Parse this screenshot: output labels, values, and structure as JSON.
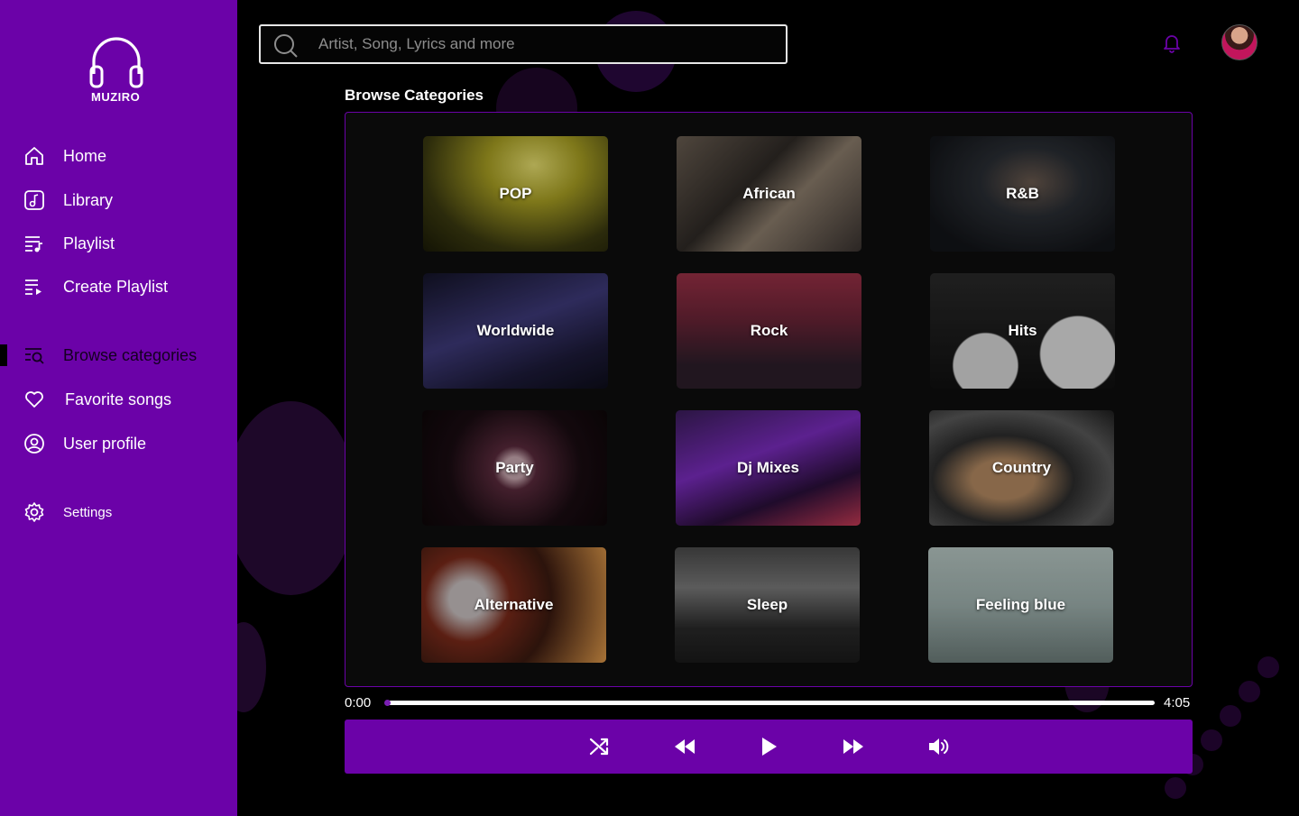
{
  "app": {
    "name": "MUZIRO"
  },
  "sidebar": {
    "items": [
      {
        "label": "Home",
        "icon": "home-icon"
      },
      {
        "label": "Library",
        "icon": "library-icon"
      },
      {
        "label": "Playlist",
        "icon": "playlist-icon"
      },
      {
        "label": "Create Playlist",
        "icon": "create-playlist-icon"
      },
      {
        "label": "Browse categories",
        "icon": "browse-icon",
        "active": true
      },
      {
        "label": "Favorite songs",
        "icon": "heart-icon"
      },
      {
        "label": "User profile",
        "icon": "user-circle-icon"
      },
      {
        "label": "Settings",
        "icon": "gear-icon"
      }
    ]
  },
  "search": {
    "placeholder": "Artist, Song, Lyrics and more"
  },
  "main": {
    "title": "Browse Categories",
    "categories": [
      "POP",
      "African",
      "R&B",
      "Worldwide",
      "Rock",
      "Hits",
      "Party",
      "Dj Mixes",
      "Country",
      "Alternative",
      "Sleep",
      "Feeling blue"
    ]
  },
  "player": {
    "current_time": "0:00",
    "duration": "4:05",
    "progress": 0.0,
    "controls": [
      "shuffle-icon",
      "rewind-icon",
      "play-icon",
      "fast-forward-icon",
      "volume-icon"
    ]
  },
  "colors": {
    "accent": "#6b02a8",
    "background": "#000000"
  }
}
